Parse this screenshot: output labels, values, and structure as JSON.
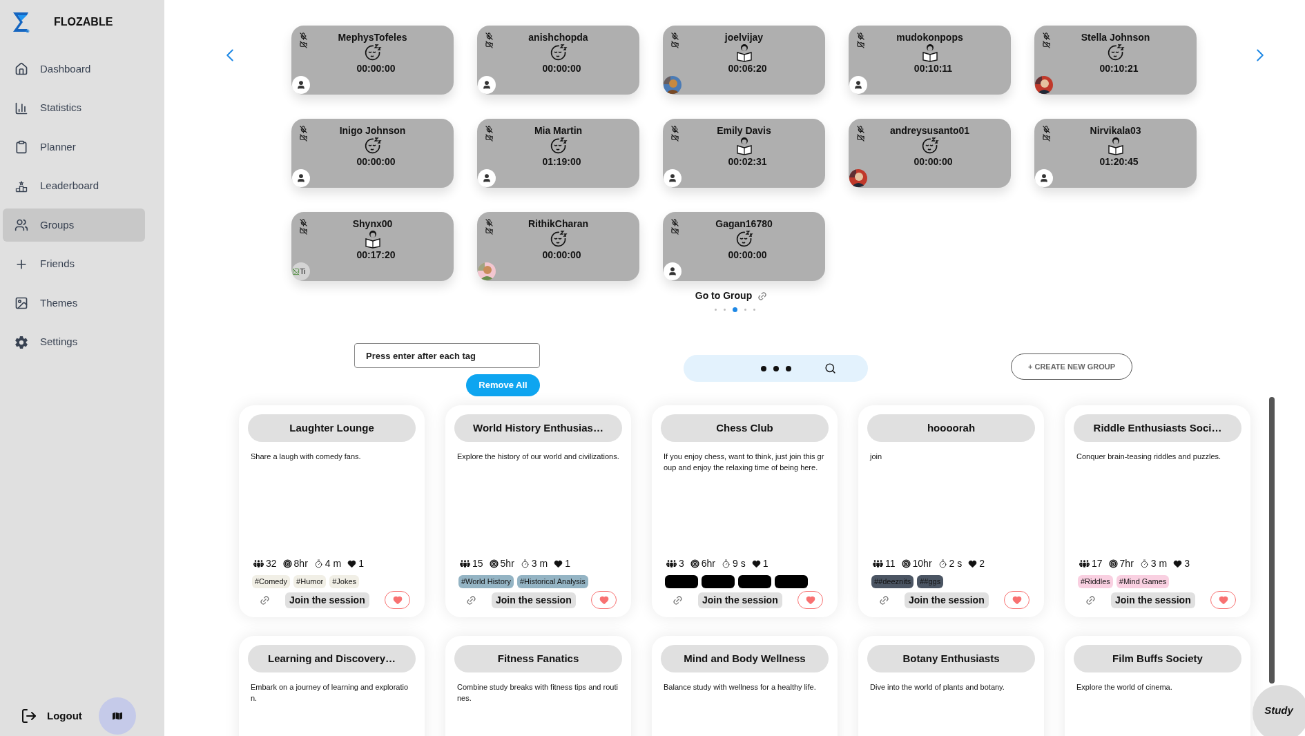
{
  "sidebar": {
    "brand": "FLOZABLE",
    "items": [
      {
        "label": "Dashboard",
        "selected": false
      },
      {
        "label": "Statistics",
        "selected": false
      },
      {
        "label": "Planner",
        "selected": false
      },
      {
        "label": "Leaderboard",
        "selected": false
      },
      {
        "label": "Groups",
        "selected": true
      },
      {
        "label": "Friends",
        "selected": false
      },
      {
        "label": "Themes",
        "selected": false
      },
      {
        "label": "Settings",
        "selected": false
      }
    ],
    "logout": "Logout"
  },
  "members": [
    {
      "name": "MephysTofeles",
      "status": {
        "kind": "sleeping"
      },
      "time": "00:00:00",
      "avatar": {
        "kind": "default"
      }
    },
    {
      "name": "anishchopda",
      "status": {
        "kind": "sleeping"
      },
      "time": "00:00:00",
      "avatar": {
        "kind": "default"
      }
    },
    {
      "name": "joelvijay",
      "status": {
        "kind": "studying"
      },
      "time": "00:06:20"
    },
    {
      "name": "mudokonpops",
      "status": {
        "kind": "studying"
      },
      "time": "00:10:11",
      "avatar": {
        "kind": "default"
      }
    },
    {
      "name": "Stella Johnson",
      "status": {
        "kind": "sleeping"
      },
      "time": "00:10:21"
    },
    {
      "name": "Inigo Johnson",
      "status": {
        "kind": "sleeping"
      },
      "time": "00:00:00",
      "avatar": {
        "kind": "default"
      }
    },
    {
      "name": "Mia Martin",
      "status": {
        "kind": "sleeping"
      },
      "time": "01:19:00",
      "avatar": {
        "kind": "default"
      }
    },
    {
      "name": "Emily Davis",
      "status": {
        "kind": "studying"
      },
      "time": "00:02:31",
      "avatar": {
        "kind": "default"
      }
    },
    {
      "name": "andreysusanto01",
      "status": {
        "kind": "sleeping"
      },
      "time": "00:00:00"
    },
    {
      "name": "Nirvikala03",
      "status": {
        "kind": "studying"
      },
      "time": "01:20:45",
      "avatar": {
        "kind": "default"
      }
    },
    {
      "name": "Shynx00",
      "status": {
        "kind": "studying"
      },
      "time": "00:17:20",
      "avatar": {
        "kind": "broken",
        "alt": "Ti"
      }
    },
    {
      "name": "RithikCharan",
      "status": {
        "kind": "sleeping"
      },
      "time": "00:00:00"
    },
    {
      "name": "Gagan16780",
      "status": {
        "kind": "sleeping"
      },
      "time": "00:00:00",
      "avatar": {
        "kind": "default"
      }
    }
  ],
  "go_to_group": "Go to Group",
  "carousel_dots": [
    {
      "selected": false
    },
    {
      "selected": false
    },
    {
      "selected": true
    },
    {
      "selected": false
    },
    {
      "selected": false
    }
  ],
  "tag_input": {
    "placeholder": "Press enter after each tag"
  },
  "remove_all": "Remove All",
  "create_group": "+ CREATE NEW GROUP",
  "groups": [
    {
      "title": "Laughter Lounge",
      "description": "Share a laugh with comedy fans.",
      "stats": [
        "32",
        "8hr",
        "4 m",
        "1"
      ],
      "tags": [
        {
          "label": "#Comedy",
          "color": "#f1efe6"
        },
        {
          "label": "#Humor",
          "color": "#f1efe6"
        },
        {
          "label": "#Jokes",
          "color": "#f1efe6"
        }
      ],
      "join": "Join the session"
    },
    {
      "title": "World History Enthusias…",
      "description": "Explore the history of our world and civilizations.",
      "stats": [
        "15",
        "5hr",
        "3 m",
        "1"
      ],
      "tags": [
        {
          "label": "#World History",
          "color": "#94b4c4"
        },
        {
          "label": "#Historical Analysis",
          "color": "#94b4c4"
        }
      ],
      "join": "Join the session"
    },
    {
      "title": "Chess Club",
      "description": "If you enjoy chess, want to think, just join this group and enjoy the relaxing time of being here.",
      "stats": [
        "3",
        "6hr",
        "9 s",
        "1"
      ],
      "tags": [
        {
          "color": "#000000"
        },
        {
          "color": "#000000"
        },
        {
          "color": "#000000"
        },
        {
          "color": "#000000"
        }
      ],
      "join": "Join the session"
    },
    {
      "title": "hoooorah",
      "description": "join",
      "stats": [
        "11",
        "10hr",
        "2 s",
        "2"
      ],
      "tags": [
        {
          "label": "##deeznits",
          "color": "#4b5563"
        },
        {
          "label": "##ggs",
          "color": "#4b5563"
        }
      ],
      "join": "Join the session"
    },
    {
      "title": "Riddle Enthusiasts Soci…",
      "description": "Conquer brain-teasing riddles and puzzles.",
      "stats": [
        "17",
        "7hr",
        "3 m",
        "3"
      ],
      "tags": [
        {
          "label": "#Riddles",
          "color": "#f9d0e1"
        },
        {
          "label": "#Mind Games",
          "color": "#f9d0e1"
        }
      ],
      "join": "Join the session"
    },
    {
      "title": "Learning and Discovery…",
      "description": "Embark on a journey of learning and exploration."
    },
    {
      "title": "Fitness Fanatics",
      "description": "Combine study breaks with fitness tips and routines."
    },
    {
      "title": "Mind and Body Wellness",
      "description": "Balance study with wellness for a healthy life."
    },
    {
      "title": "Botany Enthusiasts",
      "description": "Dive into the world of plants and botany."
    },
    {
      "title": "Film Buffs Society",
      "description": "Explore the world of cinema."
    }
  ],
  "study_button": "Study"
}
